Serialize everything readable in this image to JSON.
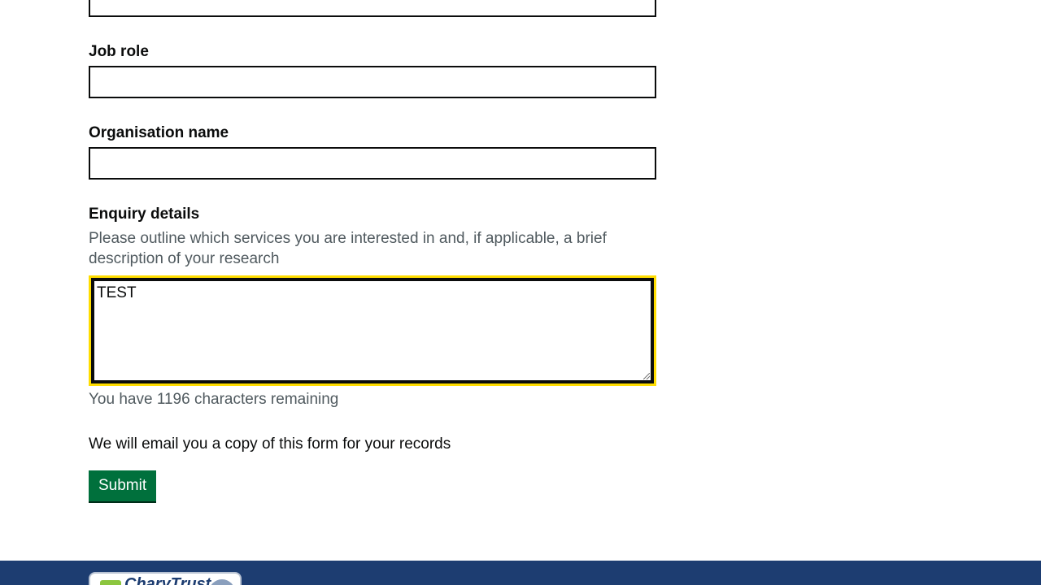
{
  "form": {
    "job_role": {
      "label": "Job role",
      "value": ""
    },
    "organisation_name": {
      "label": "Organisation name",
      "value": ""
    },
    "enquiry_details": {
      "label": "Enquiry details",
      "hint": "Please outline which services you are interested in and, if applicable, a brief description of your research",
      "value": "TEST",
      "counter": "You have 1196 characters remaining"
    },
    "email_note": "We will email you a copy of this form for your records",
    "submit_label": "Submit"
  },
  "footer": {
    "badge_text": "CharyTrust"
  },
  "colors": {
    "submit_bg": "#00703c",
    "focus_ring": "#ffdd00",
    "footer_bg": "#1d3d71",
    "hint_text": "#505a5f"
  }
}
